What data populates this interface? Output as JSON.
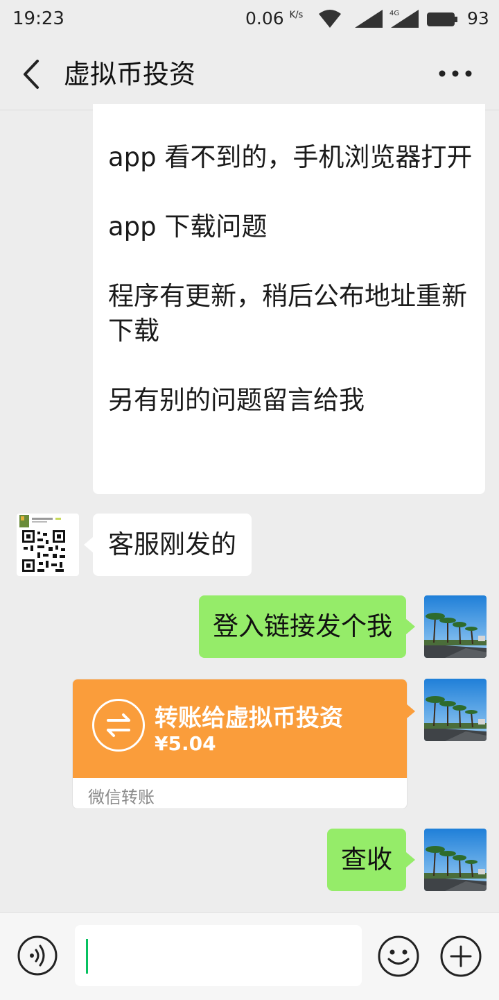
{
  "status_bar": {
    "time": "19:23",
    "net_speed": "0.06",
    "net_unit": "K/s",
    "network_label": "4G",
    "battery": "93"
  },
  "header": {
    "title": "虚拟币投资"
  },
  "messages": [
    {
      "direction": "in",
      "paragraphs": [
        "app 看不到的，手机浏览器打开",
        "app 下载问题",
        "程序有更新，稍后公布地址重新下载",
        "另有别的问题留言给我"
      ]
    },
    {
      "direction": "in",
      "text": "客服刚发的"
    },
    {
      "direction": "out",
      "text": "登入链接发个我"
    },
    {
      "direction": "out",
      "type": "transfer",
      "title": "转账给虚拟币投资",
      "amount": "¥5.04",
      "footer": "微信转账"
    },
    {
      "direction": "out",
      "text": "查收"
    }
  ],
  "input_bar": {
    "text_value": ""
  },
  "colors": {
    "background": "#ededed",
    "incoming_bubble": "#ffffff",
    "outgoing_bubble": "#95ec69",
    "transfer_card": "#fa9d3b",
    "caret": "#07c160"
  }
}
